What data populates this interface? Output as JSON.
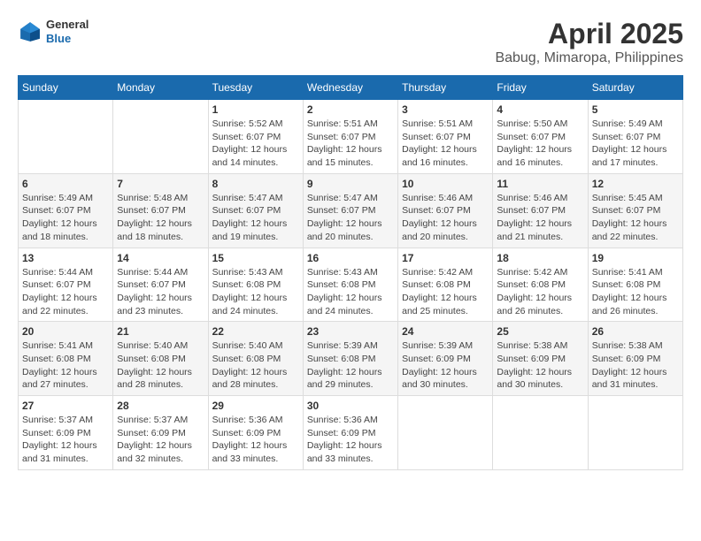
{
  "header": {
    "logo_line1": "General",
    "logo_line2": "Blue",
    "title": "April 2025",
    "subtitle": "Babug, Mimaropa, Philippines"
  },
  "weekdays": [
    "Sunday",
    "Monday",
    "Tuesday",
    "Wednesday",
    "Thursday",
    "Friday",
    "Saturday"
  ],
  "weeks": [
    [
      {
        "day": "",
        "info": ""
      },
      {
        "day": "",
        "info": ""
      },
      {
        "day": "1",
        "info": "Sunrise: 5:52 AM\nSunset: 6:07 PM\nDaylight: 12 hours and 14 minutes."
      },
      {
        "day": "2",
        "info": "Sunrise: 5:51 AM\nSunset: 6:07 PM\nDaylight: 12 hours and 15 minutes."
      },
      {
        "day": "3",
        "info": "Sunrise: 5:51 AM\nSunset: 6:07 PM\nDaylight: 12 hours and 16 minutes."
      },
      {
        "day": "4",
        "info": "Sunrise: 5:50 AM\nSunset: 6:07 PM\nDaylight: 12 hours and 16 minutes."
      },
      {
        "day": "5",
        "info": "Sunrise: 5:49 AM\nSunset: 6:07 PM\nDaylight: 12 hours and 17 minutes."
      }
    ],
    [
      {
        "day": "6",
        "info": "Sunrise: 5:49 AM\nSunset: 6:07 PM\nDaylight: 12 hours and 18 minutes."
      },
      {
        "day": "7",
        "info": "Sunrise: 5:48 AM\nSunset: 6:07 PM\nDaylight: 12 hours and 18 minutes."
      },
      {
        "day": "8",
        "info": "Sunrise: 5:47 AM\nSunset: 6:07 PM\nDaylight: 12 hours and 19 minutes."
      },
      {
        "day": "9",
        "info": "Sunrise: 5:47 AM\nSunset: 6:07 PM\nDaylight: 12 hours and 20 minutes."
      },
      {
        "day": "10",
        "info": "Sunrise: 5:46 AM\nSunset: 6:07 PM\nDaylight: 12 hours and 20 minutes."
      },
      {
        "day": "11",
        "info": "Sunrise: 5:46 AM\nSunset: 6:07 PM\nDaylight: 12 hours and 21 minutes."
      },
      {
        "day": "12",
        "info": "Sunrise: 5:45 AM\nSunset: 6:07 PM\nDaylight: 12 hours and 22 minutes."
      }
    ],
    [
      {
        "day": "13",
        "info": "Sunrise: 5:44 AM\nSunset: 6:07 PM\nDaylight: 12 hours and 22 minutes."
      },
      {
        "day": "14",
        "info": "Sunrise: 5:44 AM\nSunset: 6:07 PM\nDaylight: 12 hours and 23 minutes."
      },
      {
        "day": "15",
        "info": "Sunrise: 5:43 AM\nSunset: 6:08 PM\nDaylight: 12 hours and 24 minutes."
      },
      {
        "day": "16",
        "info": "Sunrise: 5:43 AM\nSunset: 6:08 PM\nDaylight: 12 hours and 24 minutes."
      },
      {
        "day": "17",
        "info": "Sunrise: 5:42 AM\nSunset: 6:08 PM\nDaylight: 12 hours and 25 minutes."
      },
      {
        "day": "18",
        "info": "Sunrise: 5:42 AM\nSunset: 6:08 PM\nDaylight: 12 hours and 26 minutes."
      },
      {
        "day": "19",
        "info": "Sunrise: 5:41 AM\nSunset: 6:08 PM\nDaylight: 12 hours and 26 minutes."
      }
    ],
    [
      {
        "day": "20",
        "info": "Sunrise: 5:41 AM\nSunset: 6:08 PM\nDaylight: 12 hours and 27 minutes."
      },
      {
        "day": "21",
        "info": "Sunrise: 5:40 AM\nSunset: 6:08 PM\nDaylight: 12 hours and 28 minutes."
      },
      {
        "day": "22",
        "info": "Sunrise: 5:40 AM\nSunset: 6:08 PM\nDaylight: 12 hours and 28 minutes."
      },
      {
        "day": "23",
        "info": "Sunrise: 5:39 AM\nSunset: 6:08 PM\nDaylight: 12 hours and 29 minutes."
      },
      {
        "day": "24",
        "info": "Sunrise: 5:39 AM\nSunset: 6:09 PM\nDaylight: 12 hours and 30 minutes."
      },
      {
        "day": "25",
        "info": "Sunrise: 5:38 AM\nSunset: 6:09 PM\nDaylight: 12 hours and 30 minutes."
      },
      {
        "day": "26",
        "info": "Sunrise: 5:38 AM\nSunset: 6:09 PM\nDaylight: 12 hours and 31 minutes."
      }
    ],
    [
      {
        "day": "27",
        "info": "Sunrise: 5:37 AM\nSunset: 6:09 PM\nDaylight: 12 hours and 31 minutes."
      },
      {
        "day": "28",
        "info": "Sunrise: 5:37 AM\nSunset: 6:09 PM\nDaylight: 12 hours and 32 minutes."
      },
      {
        "day": "29",
        "info": "Sunrise: 5:36 AM\nSunset: 6:09 PM\nDaylight: 12 hours and 33 minutes."
      },
      {
        "day": "30",
        "info": "Sunrise: 5:36 AM\nSunset: 6:09 PM\nDaylight: 12 hours and 33 minutes."
      },
      {
        "day": "",
        "info": ""
      },
      {
        "day": "",
        "info": ""
      },
      {
        "day": "",
        "info": ""
      }
    ]
  ]
}
